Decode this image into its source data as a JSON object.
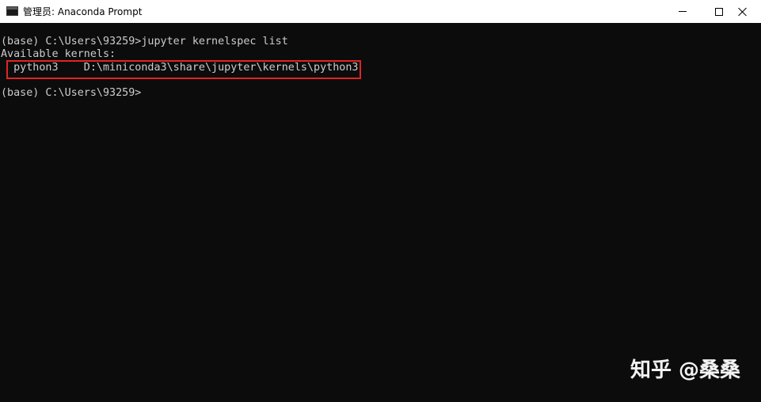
{
  "window": {
    "title": "管理员: Anaconda Prompt",
    "icon": "console-icon",
    "controls": {
      "minimize_icon": "minimize-icon",
      "maximize_icon": "maximize-icon",
      "close_icon": "close-icon"
    }
  },
  "console": {
    "lines": [
      "(base) C:\\Users\\93259>jupyter kernelspec list",
      "Available kernels:",
      "  python3    D:\\miniconda3\\share\\jupyter\\kernels\\python3",
      "(base) C:\\Users\\93259>"
    ],
    "kernel": {
      "name": "python3",
      "path": "D:\\miniconda3\\share\\jupyter\\kernels\\python3"
    },
    "colors": {
      "background": "#0c0c0c",
      "text": "#cccccc",
      "highlight_border": "#e02424"
    }
  },
  "watermark": {
    "text": "知乎 @桑桑"
  }
}
